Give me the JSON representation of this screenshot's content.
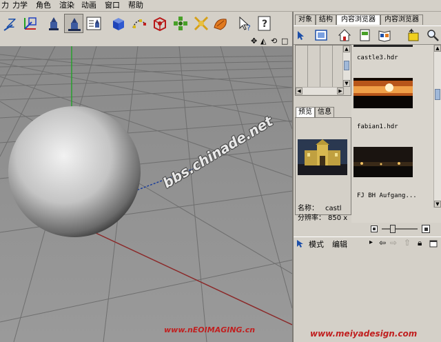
{
  "menubar": {
    "items": [
      "力学",
      "角色",
      "渲染",
      "动画",
      "窗口",
      "帮助"
    ]
  },
  "toolbar": {
    "buttons": [
      {
        "icon": "axis-z-icon"
      },
      {
        "icon": "world-axis-icon"
      },
      {
        "icon": "render-view-icon"
      },
      {
        "icon": "render-picture-viewer-icon"
      },
      {
        "icon": "render-settings-icon"
      },
      {
        "icon": "cube-primitive-icon"
      },
      {
        "icon": "spline-pen-icon"
      },
      {
        "icon": "subdivision-nurbs-icon"
      },
      {
        "icon": "array-object-icon"
      },
      {
        "icon": "deformer-icon"
      },
      {
        "icon": "scene-floor-icon"
      },
      {
        "icon": "cursor-icon"
      },
      {
        "icon": "help-icon"
      }
    ]
  },
  "viewport": {
    "nav_icons": [
      "move-view-icon",
      "zoom-view-icon",
      "rotate-view-icon",
      "maximize-view-icon"
    ],
    "nav_glyphs": [
      "✥",
      "◭",
      "⟲",
      "□"
    ]
  },
  "right_panel": {
    "tabs": [
      "对象",
      "结构",
      "内容浏览器",
      "内容浏览器"
    ],
    "active_tab": 2,
    "preview_tabs": [
      "预览",
      "信息"
    ],
    "info": {
      "name_label": "名称：",
      "name_value": "castl",
      "resolution_label": "分辨率：",
      "resolution_value": "850 x"
    },
    "files": [
      {
        "name": "castle3.hdr"
      },
      {
        "name": "fabian1.hdr"
      },
      {
        "name": "FJ BH Aufgang..."
      }
    ]
  },
  "attributes": {
    "mode_label": "模式",
    "edit_label": "编辑"
  },
  "watermarks": {
    "diagonal": "bbs.chinade.net",
    "left_footer": "www.nEOIMAGING.cn",
    "right_footer": "www.meiyadesign.com"
  },
  "colors": {
    "panel_bg": "#d4d0c8",
    "viewport_bg": "#8e8e8e",
    "grid_line": "#6e6e6e",
    "y_axis": "#27a02d",
    "x_axis": "#8b2a2a",
    "selection_tab": "#ffffff"
  }
}
